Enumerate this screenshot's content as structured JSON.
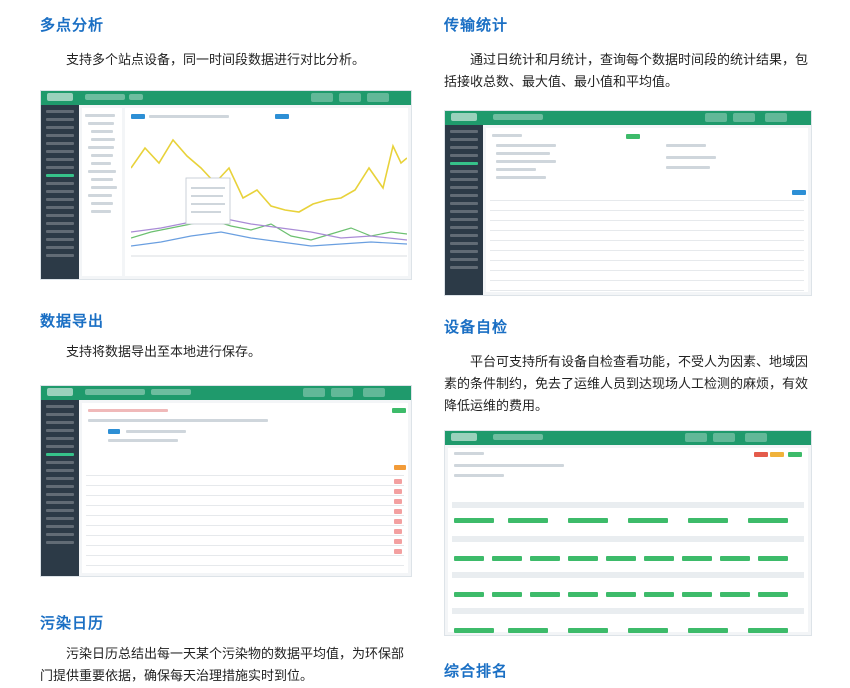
{
  "sections": {
    "multi_site": {
      "title": "多点分析",
      "text": "支持多个站点设备，同一时间段数据进行对比分析。"
    },
    "transmission": {
      "title": "传输统计",
      "text": "通过日统计和月统计，查询每个数据时间段的统计结果，包括接收总数、最大值、最小值和平均值。"
    },
    "export": {
      "title": "数据导出",
      "text": "支持将数据导出至本地进行保存。"
    },
    "self_check": {
      "title": "设备自检",
      "text": "平台可支持所有设备自检查看功能，不受人为因素、地域因素的条件制约，免去了运维人员到达现场人工检测的麻烦，有效降低运维的费用。"
    },
    "calendar": {
      "title": "污染日历",
      "text": "污染日历总结出每一天某个污染物的数据平均值，为环保部门提供重要依据，确保每天治理措施实时到位。"
    },
    "ranking": {
      "title": "综合排名"
    }
  },
  "colors": {
    "heading": "#1a6fc4",
    "app_header": "#1f9a6c",
    "sidebar": "#2c3a47",
    "chart_yellow": "#e8d23a",
    "chart_green": "#6cc070",
    "chart_blue": "#6a9fe0",
    "chart_purple": "#a98bd6"
  }
}
